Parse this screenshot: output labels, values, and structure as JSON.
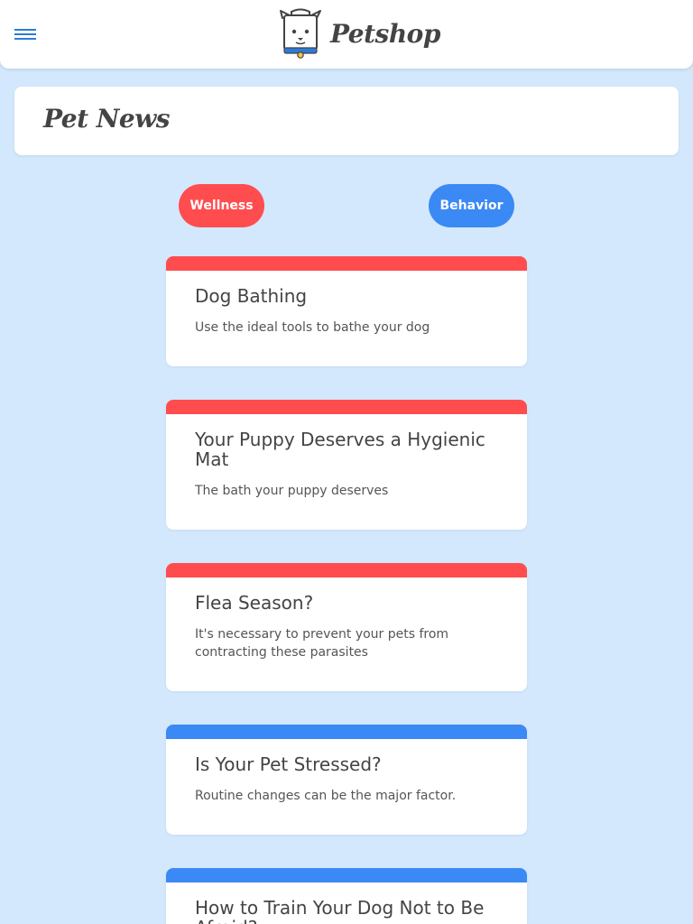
{
  "header": {
    "brand": "Petshop",
    "menu_icon": "hamburger-menu-icon",
    "logo_icon": "dog-logo-icon",
    "accent_color": "#2d7bd8"
  },
  "page": {
    "title": "Pet News",
    "background_color": "#d3e8fd"
  },
  "filters": [
    {
      "label": "Wellness",
      "color": "#ff4d4f"
    },
    {
      "label": "Behavior",
      "color": "#3b89f4"
    }
  ],
  "articles": [
    {
      "category": "Wellness",
      "title": "Dog Bathing",
      "description": "Use the ideal tools to bathe your dog"
    },
    {
      "category": "Wellness",
      "title": "Your Puppy Deserves a Hygienic Mat",
      "description": "The bath your puppy deserves"
    },
    {
      "category": "Wellness",
      "title": "Flea Season?",
      "description": "It's necessary to prevent your pets from contracting these parasites"
    },
    {
      "category": "Behavior",
      "title": "Is Your Pet Stressed?",
      "description": "Routine changes can be the major factor."
    },
    {
      "category": "Behavior",
      "title": "How to Train Your Dog Not to Be Afraid?",
      "description": ""
    }
  ]
}
